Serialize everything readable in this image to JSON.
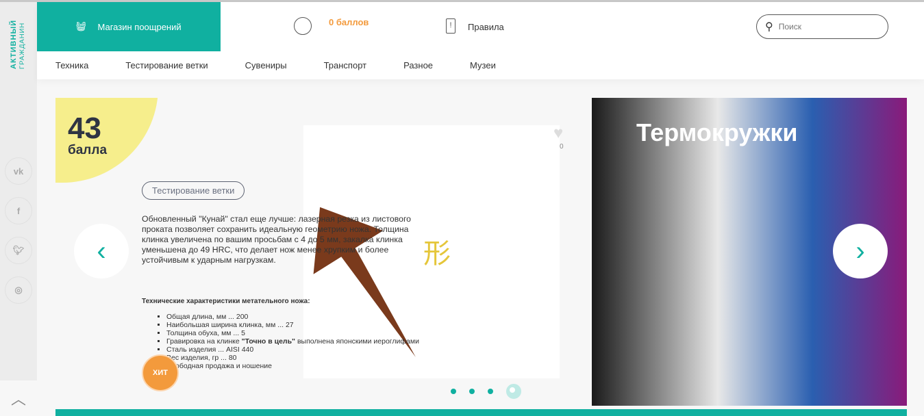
{
  "brand": {
    "line1": "АКТИВНЫЙ",
    "line2": "ГРАЖДАНИН"
  },
  "header": {
    "shop_label": "Магазин поощрений",
    "points": "0 баллов",
    "rules_label": "Правила",
    "search_placeholder": "Поиск"
  },
  "nav": [
    "Техника",
    "Тестирование ветки",
    "Сувениры",
    "Транспорт",
    "Разное",
    "Музеи"
  ],
  "social": [
    "vk",
    "f",
    "t",
    "ig"
  ],
  "product": {
    "points_value": "43",
    "points_label": "балла",
    "category": "Тестирование ветки",
    "likes": "0",
    "description": "Обновленный \"Кунай\" стал еще лучше: лазерная резка из листового проката позволяет сохранить идеальную геометрию ножа. Толщина клинка увеличена по вашим просьбам с 4 до 5 мм, закалка клинка уменьшена до 49 HRC, что делает нож менее хрупким и более устойчивым к ударным нагрузкам.",
    "specs_title": "Технические характеристики метательного ножа:",
    "specs": [
      "Общая длина, мм  ... 200",
      "Наибольшая ширина клинка, мм ... 27",
      "Толщина обуха, мм ... 5",
      "Гравировка на клинке",
      "\"Точно в цель\"",
      "выполнена японскими иероглифами",
      "Сталь изделия ... AISI 440",
      "Вес изделия, гр ... 80",
      "Свободная продажа и ношение"
    ],
    "hit_badge": "ХИТ",
    "kanji": "形"
  },
  "promo": {
    "title": "Термокружки"
  },
  "slider": {
    "current": 4,
    "total": 4
  },
  "colors": {
    "accent": "#10b0a0",
    "orange": "#f39a3c",
    "yellow": "#f6ee8c"
  }
}
